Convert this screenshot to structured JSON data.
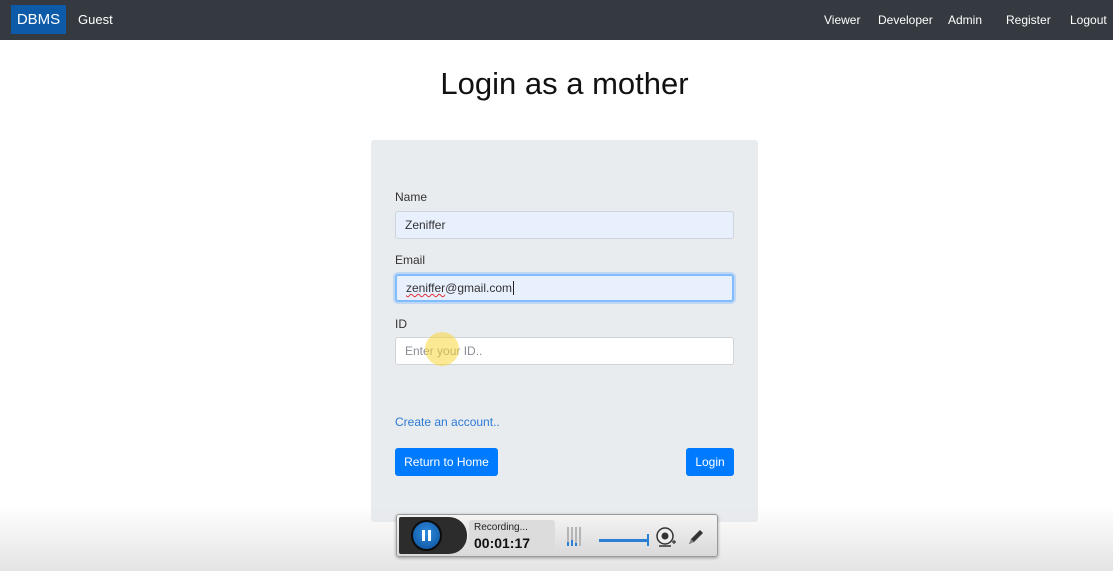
{
  "navbar": {
    "brand": "DBMS",
    "user": "Guest",
    "links": [
      "Viewer",
      "Developer",
      "Admin",
      "Register",
      "Logout"
    ]
  },
  "page": {
    "title": "Login as a mother"
  },
  "form": {
    "name_label": "Name",
    "name_value": "Zeniffer",
    "email_label": "Email",
    "email_value_misspelled": "zeniffer",
    "email_value_rest": "@gmail.com",
    "id_label": "ID",
    "id_placeholder": "Enter your ID..",
    "create_account_link": "Create an account..",
    "return_button": "Return to Home",
    "login_button": "Login"
  },
  "recorder": {
    "status": "Recording...",
    "elapsed": "00:01:17",
    "accent_color": "#2a7fd4"
  },
  "colors": {
    "navbar_bg": "#343a40",
    "brand_bg": "#0d5ba8",
    "primary": "#007bff",
    "card_bg": "#e9ecef"
  }
}
